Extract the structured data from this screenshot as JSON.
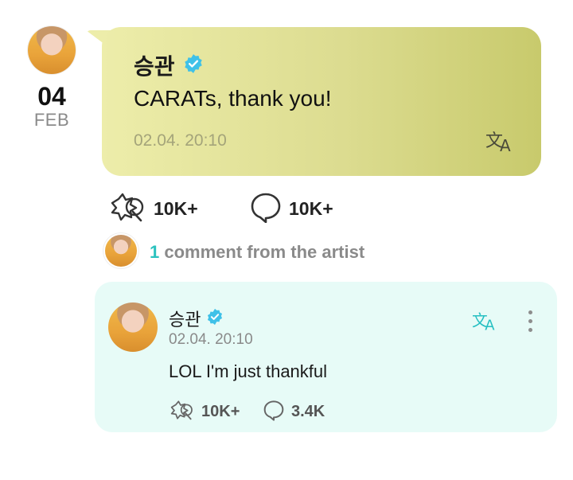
{
  "post": {
    "date_day": "04",
    "date_month": "FEB",
    "author": "승관",
    "text": "CARATs, thank you!",
    "time": "02.04. 20:10",
    "likes": "10K+",
    "comments": "10K+",
    "icons": [
      "verified-badge-icon",
      "translate-icon",
      "like-star-icon",
      "comment-bubble-icon"
    ]
  },
  "artist_comments": {
    "count": "1",
    "label": " comment from the artist"
  },
  "comment": {
    "author": "승관",
    "time": "02.04. 20:10",
    "text": "LOL I'm just thankful",
    "likes": "10K+",
    "replies": "3.4K",
    "icons": [
      "verified-badge-icon",
      "translate-icon",
      "more-vertical-icon",
      "like-star-icon",
      "comment-bubble-icon"
    ]
  },
  "colors": {
    "bubble_start": "#ededaa",
    "bubble_end": "#c8ca6c",
    "comment_bg": "#e7fbf7",
    "accent_teal": "#2cc2bf",
    "verified_blue": "#3fc1e8"
  }
}
